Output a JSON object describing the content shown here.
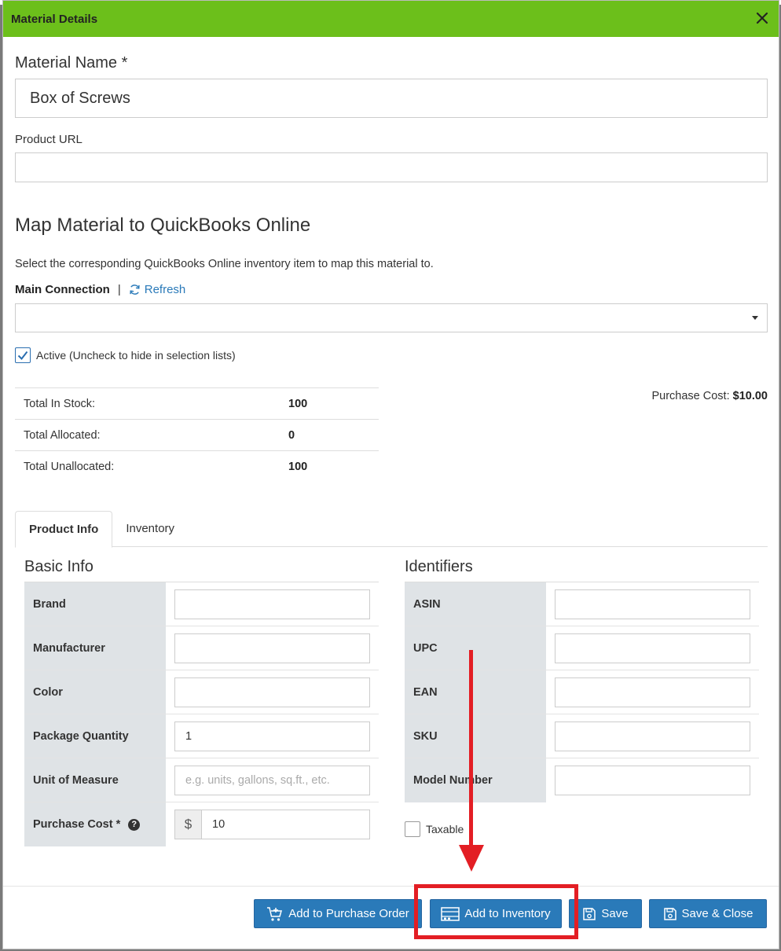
{
  "modal": {
    "title": "Material Details"
  },
  "material_name": {
    "label": "Material Name *",
    "value": "Box of Screws"
  },
  "product_url": {
    "label": "Product URL",
    "value": ""
  },
  "quickbooks": {
    "heading": "Map Material to QuickBooks Online",
    "description": "Select the corresponding QuickBooks Online inventory item to map this material to.",
    "connection_label": "Main Connection",
    "separator": "|",
    "refresh_label": "Refresh",
    "selected_item": ""
  },
  "active": {
    "label": "Active (Uncheck to hide in selection lists)",
    "checked": true
  },
  "stock": {
    "rows": [
      {
        "label": "Total In Stock:",
        "value": "100"
      },
      {
        "label": "Total Allocated:",
        "value": "0"
      },
      {
        "label": "Total Unallocated:",
        "value": "100"
      }
    ]
  },
  "purchase_cost_summary": {
    "label": "Purchase Cost:",
    "value": "$10.00"
  },
  "tabs": [
    {
      "label": "Product Info",
      "active": true
    },
    {
      "label": "Inventory",
      "active": false
    }
  ],
  "basic_info": {
    "title": "Basic Info",
    "fields": [
      {
        "label": "Brand",
        "value": "",
        "placeholder": ""
      },
      {
        "label": "Manufacturer",
        "value": "",
        "placeholder": ""
      },
      {
        "label": "Color",
        "value": "",
        "placeholder": ""
      },
      {
        "label": "Package Quantity",
        "value": "1",
        "placeholder": ""
      },
      {
        "label": "Unit of Measure",
        "value": "",
        "placeholder": "e.g. units, gallons, sq.ft., etc."
      },
      {
        "label": "Purchase Cost *",
        "value": "10",
        "placeholder": "",
        "prefix": "$",
        "help_icon": "question-circle-icon"
      }
    ]
  },
  "identifiers": {
    "title": "Identifiers",
    "fields": [
      {
        "label": "ASIN",
        "value": ""
      },
      {
        "label": "UPC",
        "value": ""
      },
      {
        "label": "EAN",
        "value": ""
      },
      {
        "label": "SKU",
        "value": ""
      },
      {
        "label": "Model Number",
        "value": ""
      }
    ],
    "taxable_label": "Taxable",
    "taxable_checked": false
  },
  "footer": {
    "add_to_po_label": "Add to Purchase Order",
    "add_to_inventory_label": "Add to Inventory",
    "save_label": "Save",
    "save_close_label": "Save & Close"
  },
  "colors": {
    "header_green": "#6cbf1b",
    "primary_button": "#2a7ab9",
    "link_blue": "#2a7ab9",
    "annotation_red": "#e31e24",
    "label_cell_gray": "#dfe3e6"
  },
  "icons": {
    "close": "close-icon",
    "refresh": "refresh-icon",
    "check": "checkmark-icon",
    "cart": "cart-plus-icon",
    "inventory": "warehouse-shelf-icon",
    "save": "floppy-disk-icon"
  }
}
